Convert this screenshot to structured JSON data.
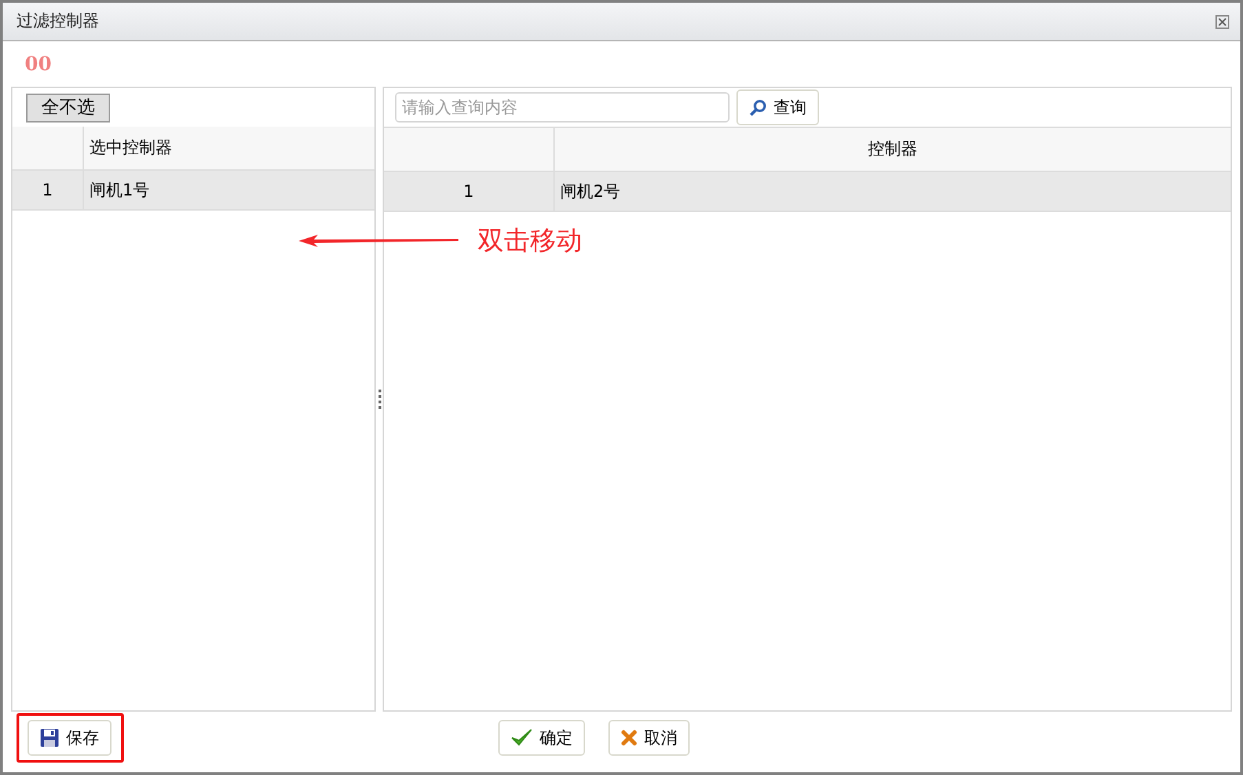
{
  "window": {
    "title": "过滤控制器"
  },
  "code": "00",
  "left_panel": {
    "toolbar_button": "全不选",
    "columns": [
      "选中控制器"
    ],
    "rows": [
      {
        "index": "1",
        "name": "闸机1号",
        "selected": true
      }
    ]
  },
  "right_panel": {
    "search": {
      "placeholder": "请输入查询内容"
    },
    "search_button": "查询",
    "columns": [
      "控制器"
    ],
    "rows": [
      {
        "index": "1",
        "name": "闸机2号",
        "selected": true
      }
    ]
  },
  "annotation": {
    "text": "双击移动"
  },
  "footer": {
    "buttons": [
      {
        "kind": "save",
        "label": "保存",
        "highlighted": true
      },
      {
        "kind": "confirm",
        "label": "确定",
        "highlighted": false
      },
      {
        "kind": "cancel",
        "label": "取消",
        "highlighted": false
      }
    ]
  }
}
